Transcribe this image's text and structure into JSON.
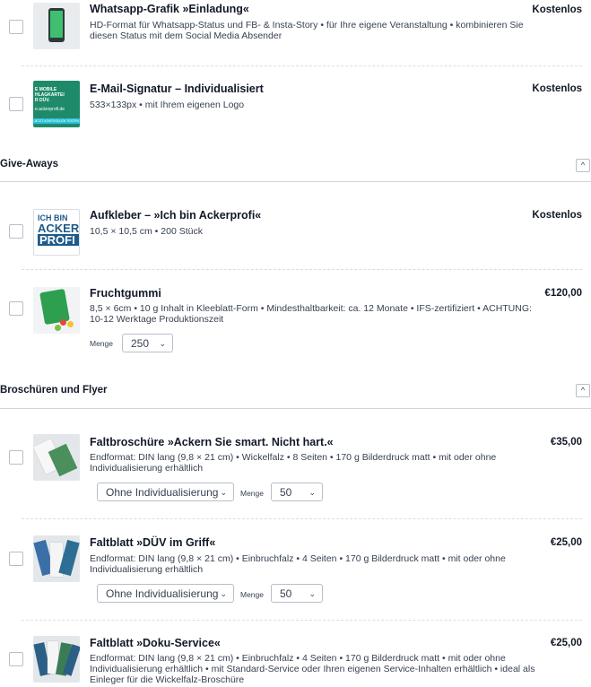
{
  "products": [
    {
      "title": "Whatsapp-Grafik »Einladung«",
      "price": "Kostenlos",
      "description": "HD-Format für Whatsapp-Status und FB- & Insta-Story • für Ihre eigene Veranstaltung • kombinieren Sie diesen Status mit dem Social Media Absender"
    },
    {
      "title": "E-Mail-Signatur – Individualisiert",
      "price": "Kostenlos",
      "description": "533×133px • mit Ihrem eigenen Logo",
      "thumb_text": [
        "E MOBILE",
        "HLAGKARTEI",
        "R DÜV.",
        "e.ackerprofi.de"
      ],
      "thumb_footer": "JETZT KONTROLLEN TESTEN"
    },
    {
      "section": "Give-Aways",
      "collapse_icon": "^"
    },
    {
      "title": "Aufkleber – »Ich bin Ackerprofi«",
      "price": "Kostenlos",
      "description": "10,5 × 10,5 cm • 200 Stück",
      "thumb_text": [
        "ICH BIN",
        "ACKER",
        "PROFI"
      ]
    },
    {
      "title": "Fruchtgummi",
      "price": "€120,00",
      "description": "8,5 × 6cm • 10 g Inhalt in Kleeblatt-Form • Mindesthaltbarkeit: ca. 12 Monate • IFS-zertifiziert • ACHTUNG: 10-12 Werktage Produktionszeit",
      "qty_label": "Menge",
      "qty_value": "250",
      "chevron": "⌄"
    },
    {
      "section": "Broschüren und Flyer",
      "collapse_icon": "^"
    },
    {
      "title": "Faltbroschüre »Ackern Sie smart. Nicht hart.«",
      "price": "€35,00",
      "description": "Endformat: DIN lang (9,8 × 21 cm) • Wickelfalz • 8 Seiten • 170 g Bilderdruck matt • mit oder ohne Individualisierung erhältlich",
      "option_value": "Ohne Individualisierung",
      "qty_label": "Menge",
      "qty_value": "50",
      "chevron": "⌄"
    },
    {
      "title": "Faltblatt »DÜV im Griff«",
      "price": "€25,00",
      "description": "Endformat: DIN lang (9,8 × 21 cm) • Einbruchfalz • 4 Seiten • 170 g Bilderdruck matt • mit oder ohne Individualisierung erhältlich",
      "option_value": "Ohne Individualisierung",
      "qty_label": "Menge",
      "qty_value": "50",
      "chevron": "⌄"
    },
    {
      "title": "Faltblatt »Doku-Service«",
      "price": "€25,00",
      "description": "Endformat: DIN lang (9,8 × 21 cm) • Einbruchfalz • 4 Seiten • 170 g Bilderdruck matt • mit oder ohne Individualisierung erhältlich • mit Standard-Service oder Ihren eigenen Service-Inhalten erhältlich • ideal als Einleger für die Wickelfalz-Broschüre"
    }
  ]
}
